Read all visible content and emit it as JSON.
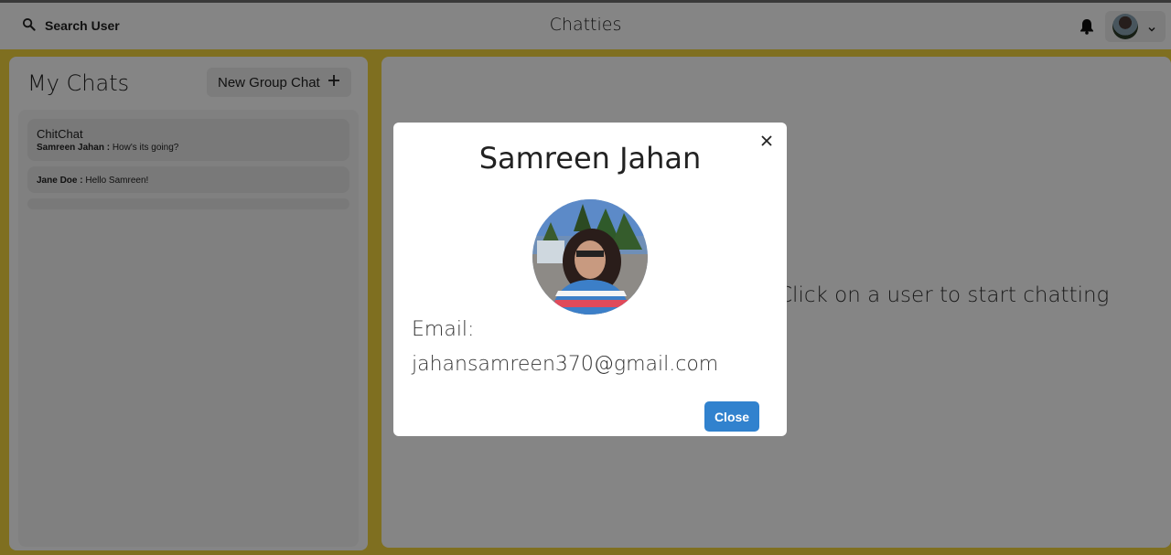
{
  "header": {
    "search_label": "Search User",
    "app_title": "Chatties"
  },
  "sidebar": {
    "title": "My Chats",
    "new_group_label": "New Group Chat",
    "chats": [
      {
        "name": "ChitChat",
        "sender": "Samreen Jahan :",
        "message": "How's its going?"
      },
      {
        "name": "",
        "sender": "Jane Doe :",
        "message": "Hello Samreen!"
      }
    ]
  },
  "main": {
    "placeholder_text": "Click on a user to start chatting"
  },
  "modal": {
    "title": "Samreen Jahan",
    "email_label": "Email:",
    "email_value": "jahansamreen370@gmail.com",
    "close_label": "Close"
  },
  "colors": {
    "accent": "#3182ce",
    "background": "#f3d53f"
  }
}
